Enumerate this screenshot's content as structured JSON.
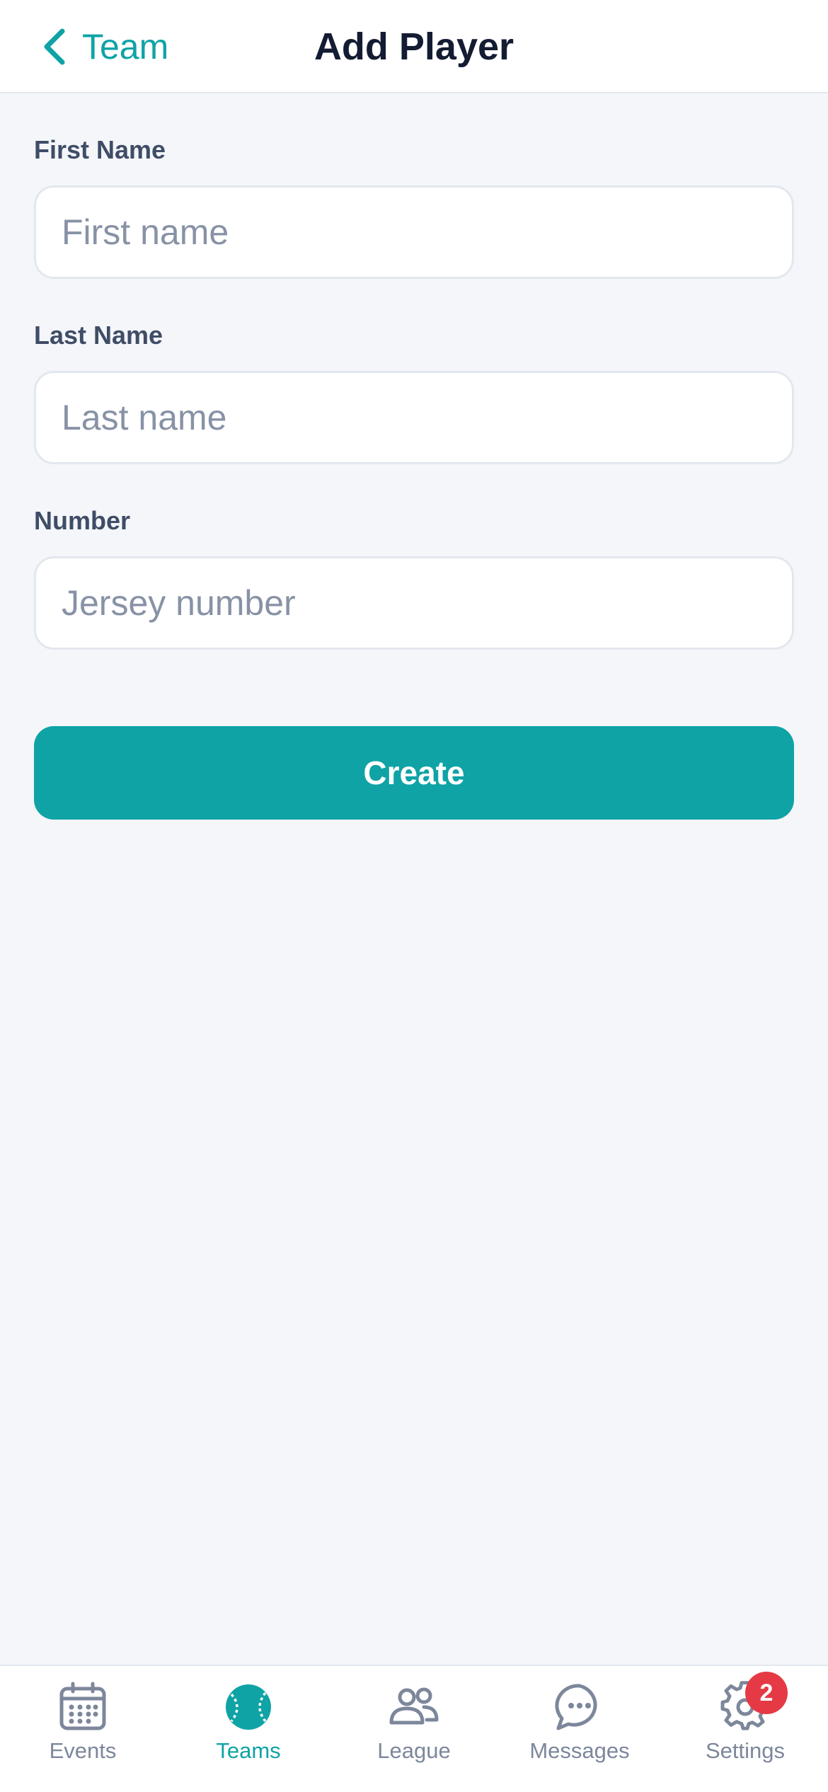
{
  "header": {
    "back_label": "Team",
    "title": "Add Player"
  },
  "form": {
    "first_name": {
      "label": "First Name",
      "placeholder": "First name",
      "value": ""
    },
    "last_name": {
      "label": "Last Name",
      "placeholder": "Last name",
      "value": ""
    },
    "number": {
      "label": "Number",
      "placeholder": "Jersey number",
      "value": ""
    },
    "submit_label": "Create"
  },
  "tabbar": {
    "active": "Teams",
    "items": [
      {
        "label": "Events",
        "icon": "calendar-icon"
      },
      {
        "label": "Teams",
        "icon": "baseball-icon"
      },
      {
        "label": "League",
        "icon": "users-icon"
      },
      {
        "label": "Messages",
        "icon": "chat-icon"
      },
      {
        "label": "Settings",
        "icon": "gear-icon",
        "badge": "2"
      }
    ]
  },
  "colors": {
    "accent": "#0fa3a6",
    "title": "#141c33",
    "badge": "#e53945",
    "inactive": "#7d879b",
    "background": "#f4f6fa"
  }
}
